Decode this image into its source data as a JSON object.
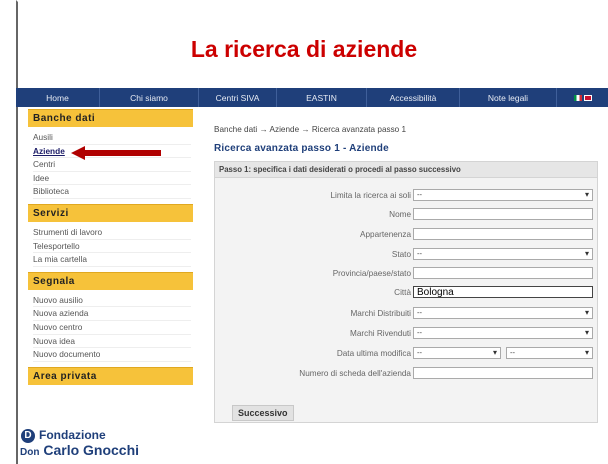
{
  "slide": {
    "title": "La ricerca di aziende"
  },
  "nav": {
    "items": [
      "Home",
      "Chi siamo",
      "Centri SIVA",
      "EASTIN",
      "Accessibilità",
      "Note legali"
    ],
    "flags": [
      "italian-flag-icon",
      "uk-flag-icon"
    ]
  },
  "sidebar": {
    "sections": [
      {
        "title": "Banche dati",
        "items": [
          "Ausili",
          "Aziende",
          "Centri",
          "Idee",
          "Biblioteca"
        ],
        "active": "Aziende"
      },
      {
        "title": "Servizi",
        "items": [
          "Strumenti di lavoro",
          "Telesportello",
          "La mia cartella"
        ]
      },
      {
        "title": "Segnala",
        "items": [
          "Nuovo ausilio",
          "Nuova azienda",
          "Nuovo centro",
          "Nuova idea",
          "Nuovo documento"
        ]
      },
      {
        "title": "Area privata",
        "items": []
      }
    ]
  },
  "main": {
    "breadcrumb": "Banche dati → Aziende → Ricerca avanzata passo 1",
    "heading": "Ricerca avanzata passo 1 - Aziende",
    "step_text": "Passo 1: specifica i dati desiderati o procedi al passo successivo",
    "fields": [
      {
        "label": "Limita la ricerca ai soli",
        "value": "--",
        "type": "select"
      },
      {
        "label": "Nome",
        "value": "",
        "type": "text"
      },
      {
        "label": "Appartenenza",
        "value": "",
        "type": "text"
      },
      {
        "label": "Stato",
        "value": "--",
        "type": "select"
      },
      {
        "label": "Provincia/paese/stato",
        "value": "",
        "type": "text"
      },
      {
        "label": "Città",
        "value": "Bologna",
        "type": "text"
      },
      {
        "label": "Marchi Distribuiti",
        "value": "--",
        "type": "select"
      },
      {
        "label": "Marchi Rivenduti",
        "value": "--",
        "type": "select"
      },
      {
        "label": "Data ultima modifica",
        "value": "--",
        "value2": "--",
        "type": "select-pair"
      },
      {
        "label": "Numero di scheda dell'azienda",
        "value": "",
        "type": "text"
      }
    ],
    "submit_label": "Successivo"
  },
  "logo": {
    "line1": "Fondazione",
    "line2": "Carlo Gnocchi",
    "prefix": "Don"
  },
  "colors": {
    "title": "#cc0000",
    "navbar": "#1f3f7a",
    "section": "#f6c23a",
    "arrow": "#b00000"
  }
}
